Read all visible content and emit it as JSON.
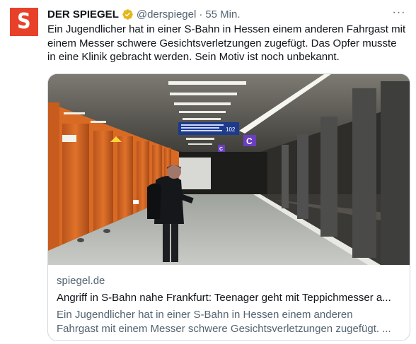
{
  "author": {
    "name": "DER SPIEGEL",
    "handle": "@derspiegel",
    "separator": "·",
    "time": "55 Min.",
    "avatar_letter": "S"
  },
  "more_label": "···",
  "tweet": {
    "line1": "Ein Jugendlicher hat in einer S-Bahn in Hessen einem anderen Fahrgast mit",
    "line2": "einem Messer schwere Gesichtsverletzungen zugefügt. Das Opfer musste",
    "line3": "in eine Klinik gebracht werden. Sein Motiv ist noch unbekannt."
  },
  "card": {
    "domain": "spiegel.de",
    "title": "Angriff in S-Bahn nahe Frankfurt: Teenager geht mit Teppichmesser a...",
    "desc_line1": "Ein Jugendlicher hat in einer S-Bahn in Hessen einem anderen",
    "desc_line2": "Fahrgast mit einem Messer schwere Gesichtsverletzungen zugefügt. ..."
  },
  "photo": {
    "sign_number": "102",
    "sign_letter": "C"
  },
  "colors": {
    "brand": "#e8412a",
    "verified": "#e2b719",
    "muted": "#536471",
    "border": "#cfd9de"
  },
  "icons": [
    "spiegel-logo-icon",
    "verified-badge-icon",
    "more-options-icon"
  ]
}
